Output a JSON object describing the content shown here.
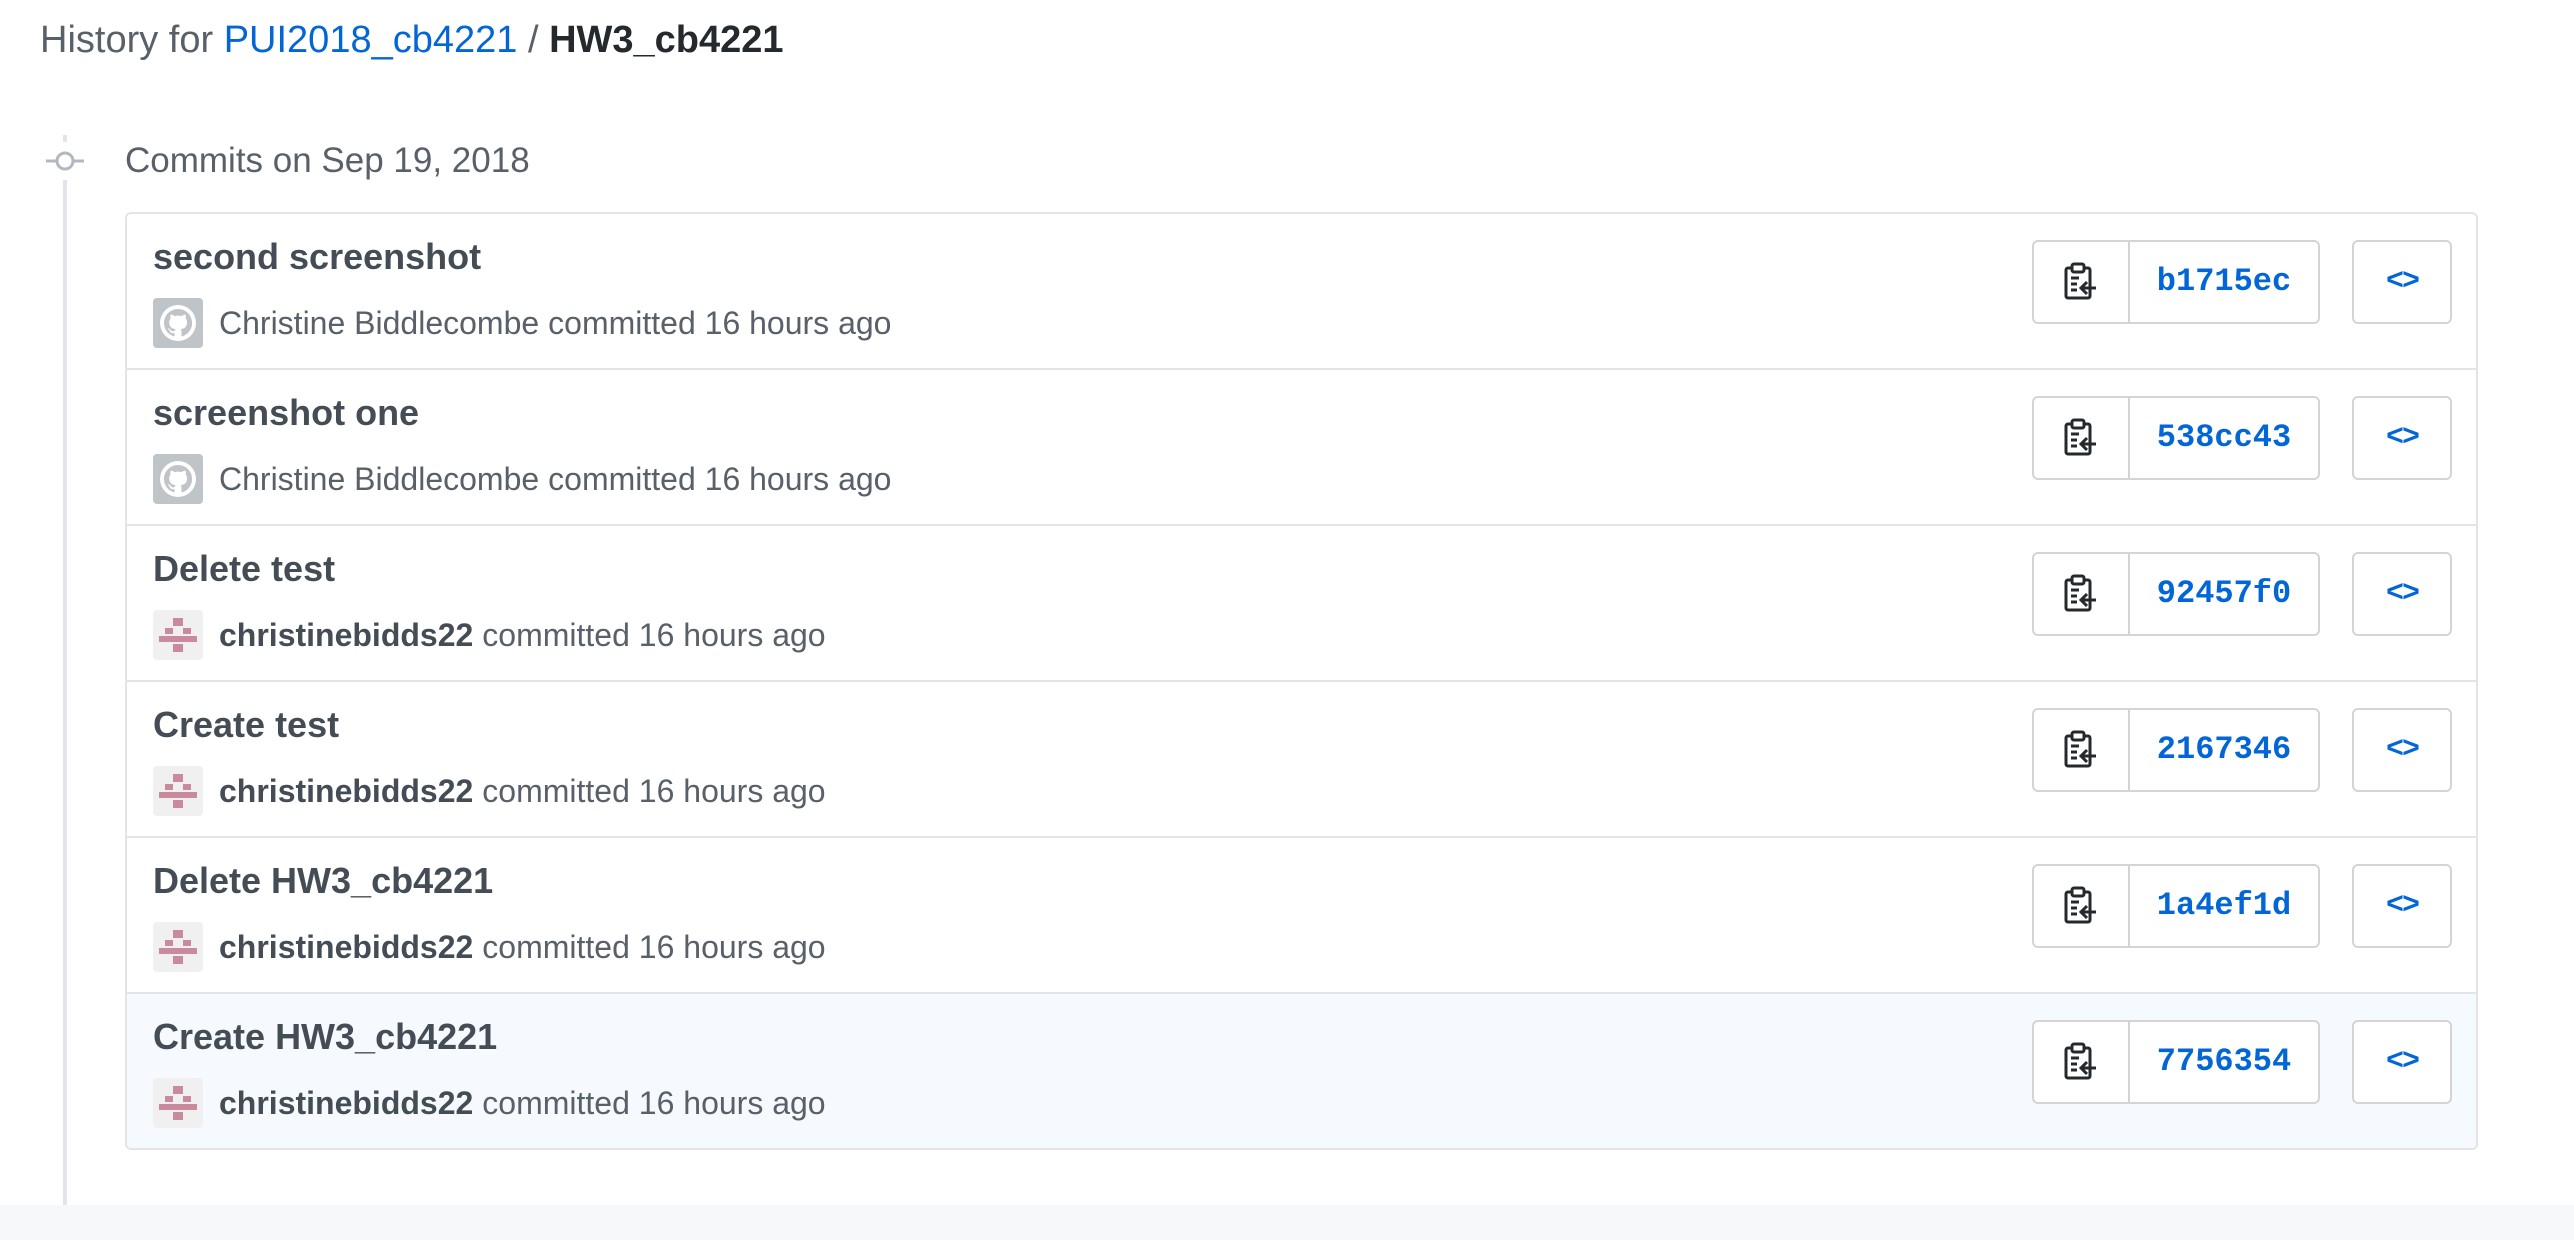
{
  "header": {
    "prefix": "History for",
    "repo": "PUI2018_cb4221",
    "separator": "/",
    "path": "HW3_cb4221"
  },
  "group": {
    "title": "Commits on Sep 19, 2018"
  },
  "commits": [
    {
      "message": "second screenshot",
      "author": "Christine Biddlecombe",
      "action": "committed 16 hours ago",
      "sha": "b1715ec",
      "avatar": "github-default-avatar"
    },
    {
      "message": "screenshot one",
      "author": "Christine Biddlecombe",
      "action": "committed 16 hours ago",
      "sha": "538cc43",
      "avatar": "github-default-avatar"
    },
    {
      "message": "Delete test",
      "author": "christinebidds22",
      "action": "committed 16 hours ago",
      "sha": "92457f0",
      "avatar": "identicon-avatar"
    },
    {
      "message": "Create test",
      "author": "christinebidds22",
      "action": "committed 16 hours ago",
      "sha": "2167346",
      "avatar": "identicon-avatar"
    },
    {
      "message": "Delete HW3_cb4221",
      "author": "christinebidds22",
      "action": "committed 16 hours ago",
      "sha": "1a4ef1d",
      "avatar": "identicon-avatar"
    },
    {
      "message": "Create HW3_cb4221",
      "author": "christinebidds22",
      "action": "committed 16 hours ago",
      "sha": "7756354",
      "avatar": "identicon-avatar"
    }
  ],
  "buttons": {
    "browse_label": "<>"
  },
  "colors": {
    "link": "#0366d6",
    "text": "#24292e",
    "muted": "#586069",
    "border": "#e1e4e8",
    "highlight_row": "#f6f9fe",
    "identicon": "#c98a9d"
  },
  "icons": {
    "copy": "clippy-icon",
    "timeline": "git-commit-icon",
    "browse": "code-icon"
  }
}
